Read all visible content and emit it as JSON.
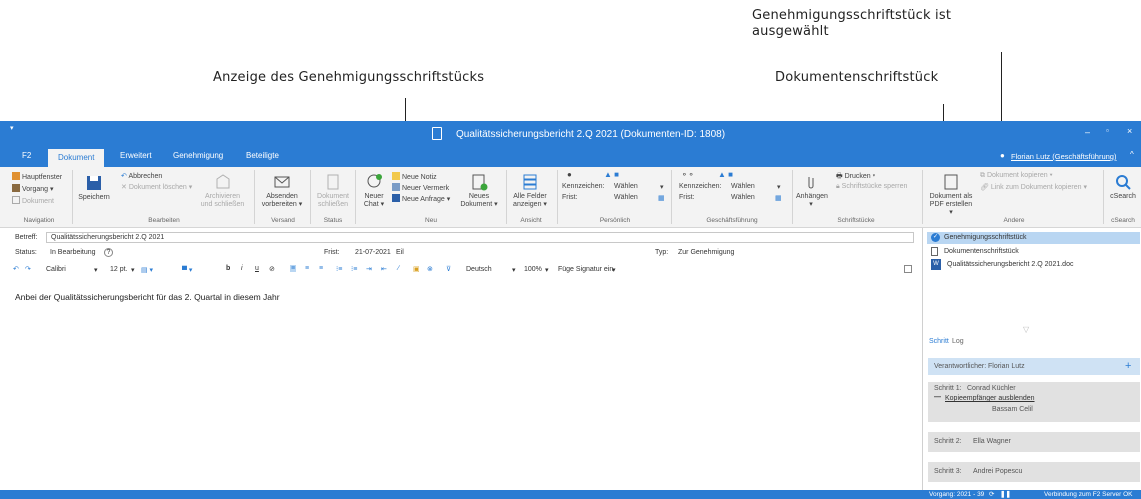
{
  "annotations": {
    "genehmigung_selected": "Genehmigungsschriftstück ist\nausgewählt",
    "anzeige": "Anzeige des Genehmigungsschriftstücks",
    "dokumentenschriftstueck": "Dokumentenschriftstück"
  },
  "window": {
    "title": "Qualitätssicherungsbericht 2.Q 2021 (Dokumenten-ID: 1808)",
    "user": "Florian Lutz (Geschäftsführung)"
  },
  "tabs": [
    "F2",
    "Dokument",
    "Erweitert",
    "Genehmigung",
    "Beteiligte"
  ],
  "ribbon": {
    "navigation": {
      "label": "Navigation",
      "hauptfenster": "Hauptfenster",
      "vorgang": "Vorgang",
      "dokument": "Dokument"
    },
    "bearbeiten": {
      "label": "Bearbeiten",
      "speichern": "Speichern",
      "abbrechen": "Abbrechen",
      "loeschen": "Dokument löschen",
      "archivieren": "Archivieren\nund schließen"
    },
    "versand": {
      "label": "Versand",
      "absenden": "Absenden\nvorbereiten"
    },
    "status": {
      "label": "Status",
      "schliessen": "Dokument\nschließen"
    },
    "neu": {
      "label": "Neu",
      "chat": "Neuer\nChat",
      "notiz": "Neue Notiz",
      "vermerk": "Neuer Vermerk",
      "anfrage": "Neue Anfrage",
      "dokument": "Neues\nDokument"
    },
    "ansicht": {
      "label": "Ansicht",
      "felder": "Alle Felder\nanzeigen"
    },
    "persoenlich": {
      "label": "Persönlich",
      "kennzeichen": "Kennzeichen:",
      "frist": "Frist:",
      "waehlen": "Wählen"
    },
    "geschaeftsfuehrung": {
      "label": "Geschäftsführung",
      "kennzeichen": "Kennzeichen:",
      "frist": "Frist:",
      "waehlen": "Wählen"
    },
    "schriftstuecke": {
      "label": "Schriftstücke",
      "anhaengen": "Anhängen",
      "drucken": "Drucken",
      "sperren": "Schriftstücke sperren"
    },
    "andere": {
      "label": "Andere",
      "pdf": "Dokument als\nPDF erstellen",
      "kopieren": "Dokument kopieren",
      "link": "Link zum Dokument kopieren"
    },
    "csearch": {
      "label": "cSearch",
      "btn": "cSearch"
    }
  },
  "form": {
    "betreff_label": "Betreff:",
    "betreff_value": "Qualitätssicherungsbericht 2.Q 2021",
    "status_label": "Status:",
    "status_value": "In Bearbeitung",
    "frist_label": "Frist:",
    "frist_value": "21-07-2021",
    "frist_suffix": "Eil",
    "typ_label": "Typ:",
    "typ_value": "Zur Genehmigung"
  },
  "format_toolbar": {
    "font": "Calibri",
    "size": "12 pt.",
    "language": "Deutsch",
    "zoom": "100%",
    "signatur": "Füge Signatur ein"
  },
  "editor": {
    "text": "Anbei der Qualitätssicherungsbericht für das 2. Quartal in diesem Jahr"
  },
  "documents": [
    {
      "name": "Genehmigungsschriftstück",
      "selected": true
    },
    {
      "name": "Dokumentenschriftstück",
      "selected": false
    },
    {
      "name": "Qualitätssicherungsbericht 2.Q 2021.doc",
      "selected": false
    }
  ],
  "workflow": {
    "tab_schritt": "Schritt",
    "tab_log": "Log",
    "verantwortlicher_label": "Verantwortlicher:",
    "verantwortlicher": "Florian Lutz",
    "steps": [
      {
        "label": "Schritt 1:",
        "name": "Conrad Küchler",
        "link": "Kopieempfänger ausblenden",
        "extra": "Bassam Celil"
      },
      {
        "label": "Schritt 2:",
        "name": "Ella Wagner"
      },
      {
        "label": "Schritt 3:",
        "name": "Andrei Popescu"
      }
    ]
  },
  "statusbar": {
    "vorgang": "Vorgang: 2021 - 39",
    "verbindung": "Verbindung zum F2 Server OK"
  },
  "colors": {
    "accent": "#2b7cd3",
    "selection": "#b9d6f2"
  }
}
